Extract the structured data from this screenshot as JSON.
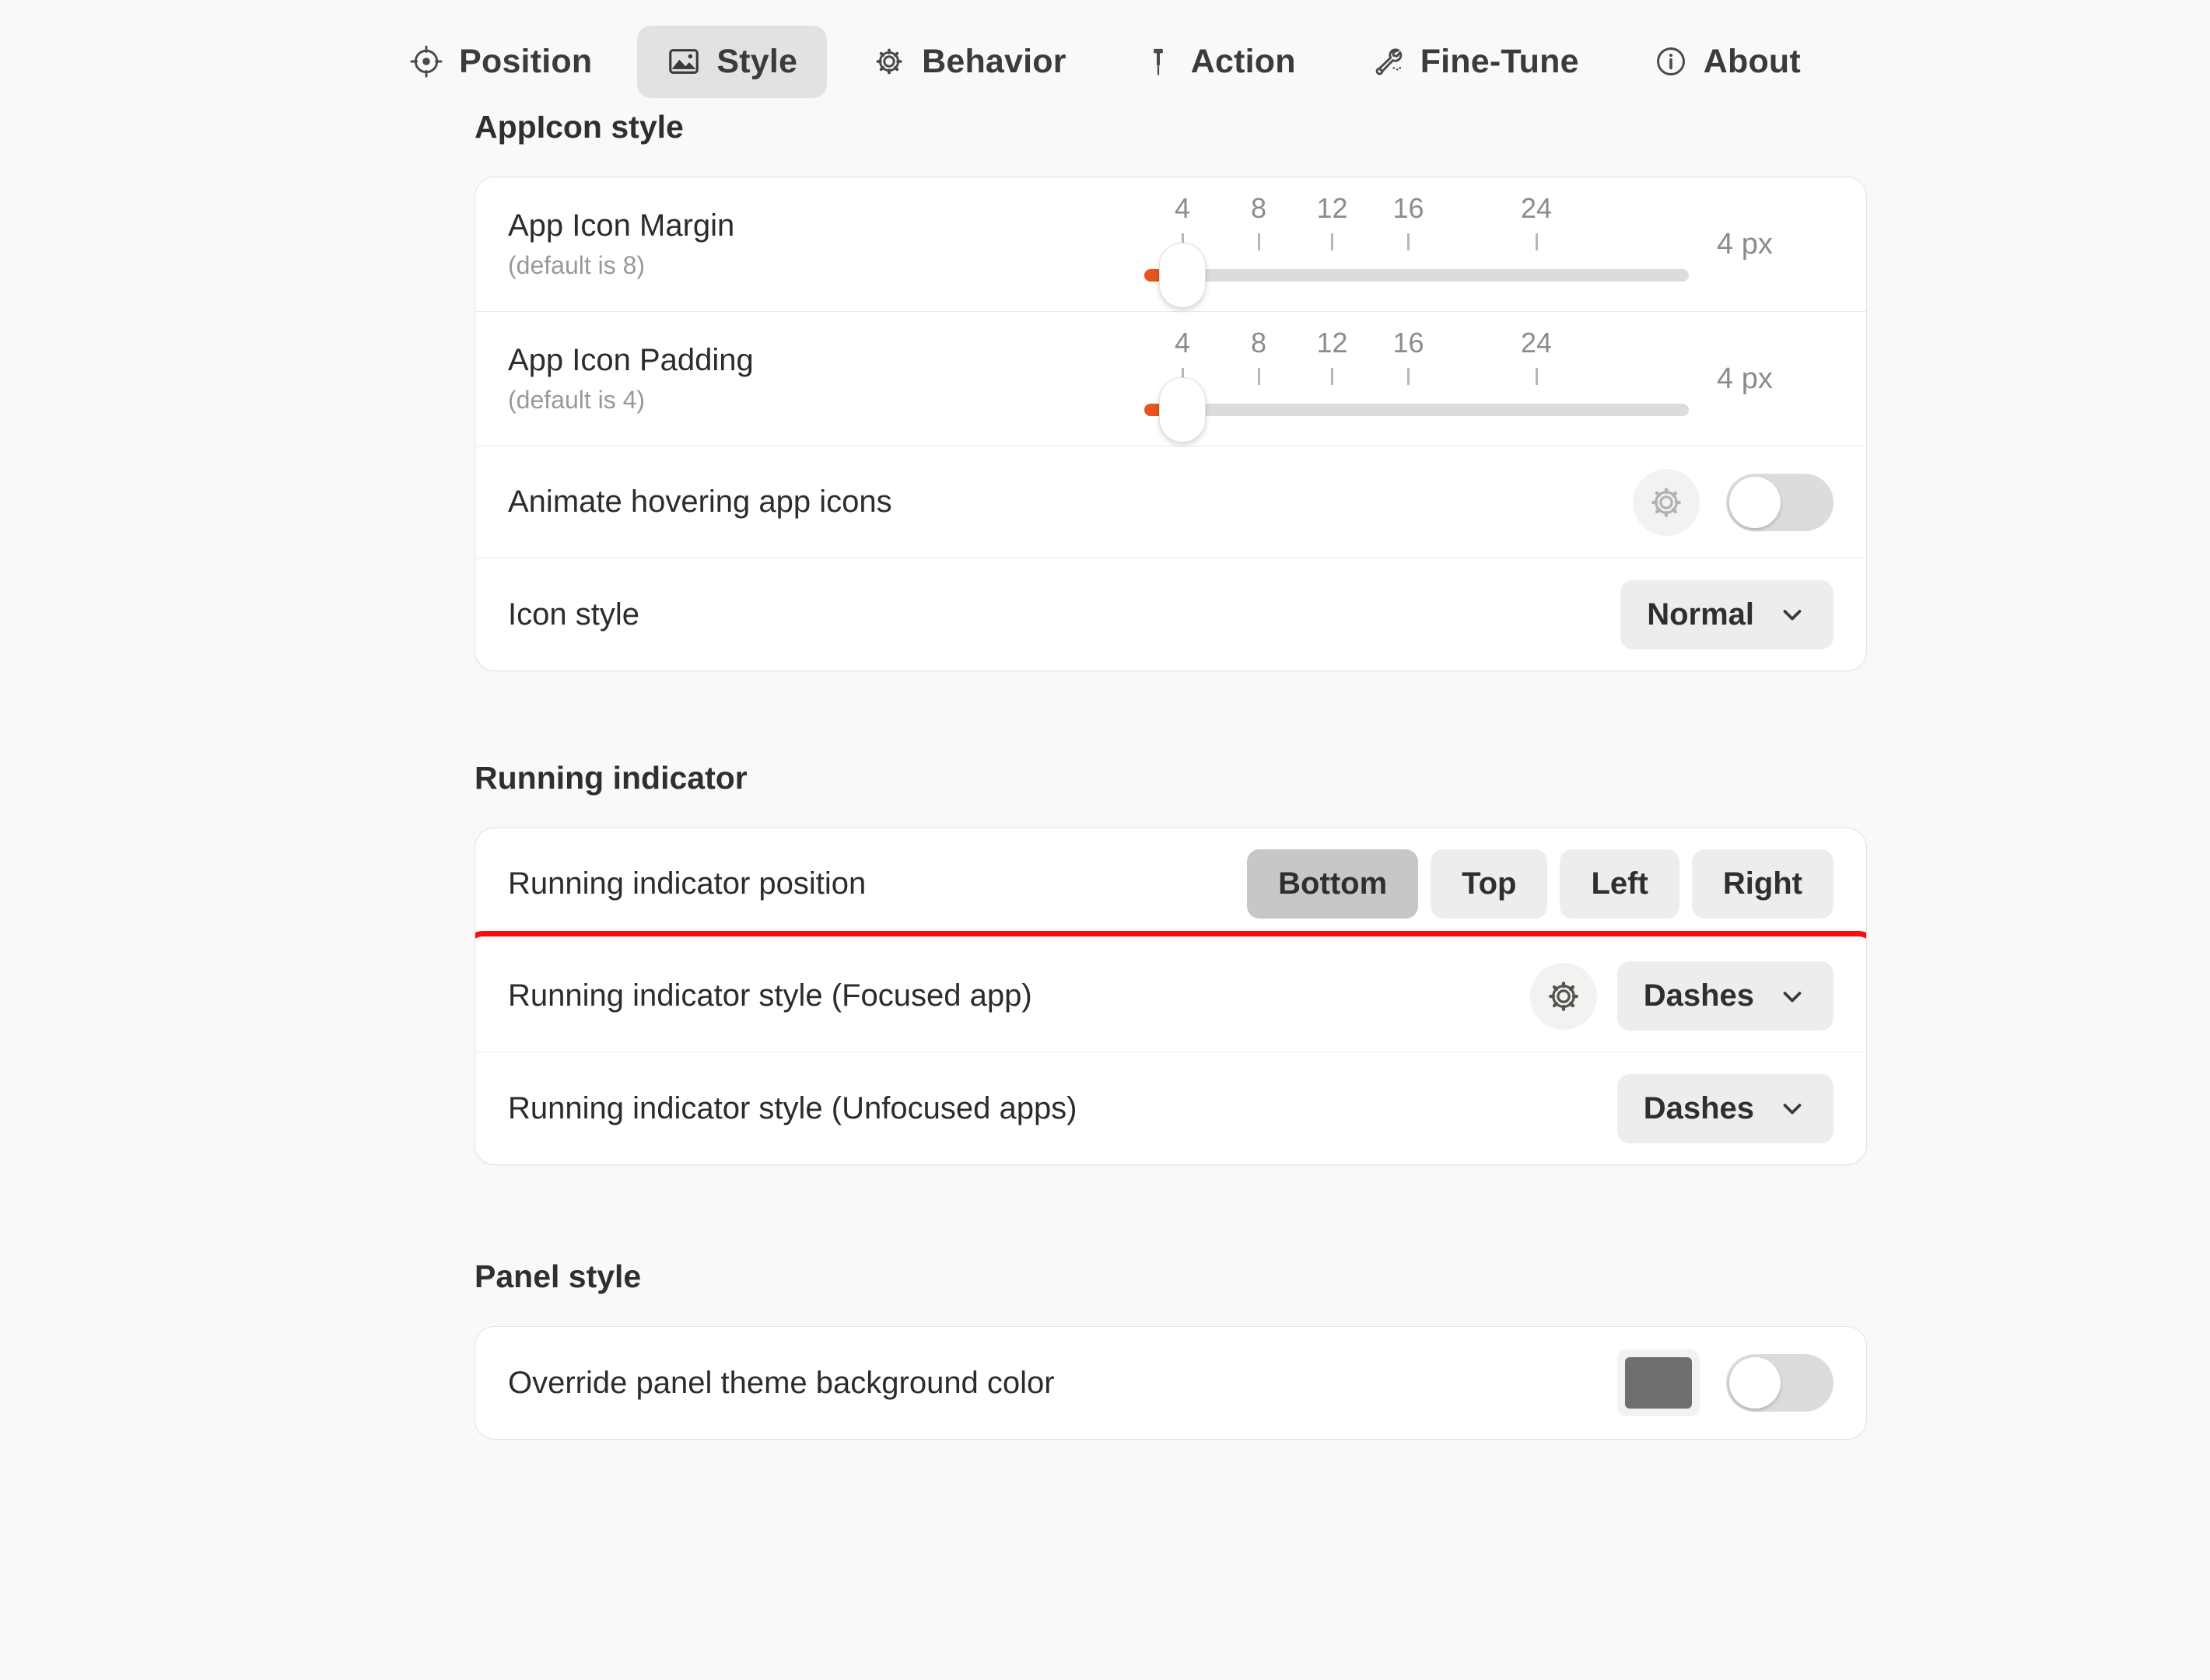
{
  "tabs": [
    {
      "label": "Position",
      "icon": "crosshair-icon",
      "active": false
    },
    {
      "label": "Style",
      "icon": "image-icon",
      "active": true
    },
    {
      "label": "Behavior",
      "icon": "gear-icon",
      "active": false
    },
    {
      "label": "Action",
      "icon": "pin-icon",
      "active": false
    },
    {
      "label": "Fine-Tune",
      "icon": "wrench-icon",
      "active": false
    },
    {
      "label": "About",
      "icon": "info-icon",
      "active": false
    }
  ],
  "sections": {
    "appicon": {
      "title": "AppIcon style",
      "margin": {
        "label": "App Icon Margin",
        "sublabel": "(default is 8)",
        "value": 4,
        "value_label": "4 px",
        "ticks": [
          4,
          8,
          12,
          16,
          24
        ],
        "tick_labels": [
          "4",
          "8",
          "12",
          "16",
          "24"
        ],
        "min": 0,
        "max": 32
      },
      "padding": {
        "label": "App Icon Padding",
        "sublabel": "(default is 4)",
        "value": 4,
        "value_label": "4 px",
        "ticks": [
          4,
          8,
          12,
          16,
          24
        ],
        "tick_labels": [
          "4",
          "8",
          "12",
          "16",
          "24"
        ],
        "min": 0,
        "max": 32
      },
      "animate": {
        "label": "Animate hovering app icons",
        "toggle_on": false,
        "has_gear": true
      },
      "icon_style": {
        "label": "Icon style",
        "value": "Normal",
        "options": [
          "Normal"
        ]
      }
    },
    "running": {
      "title": "Running indicator",
      "position": {
        "label": "Running indicator position",
        "options": [
          "Bottom",
          "Top",
          "Left",
          "Right"
        ],
        "selected": "Bottom"
      },
      "focused": {
        "label": "Running indicator style (Focused app)",
        "value": "Dashes",
        "has_gear": true,
        "highlighted": true
      },
      "unfocused": {
        "label": "Running indicator style (Unfocused apps)",
        "value": "Dashes",
        "has_gear": false,
        "highlighted": true
      }
    },
    "panel": {
      "title": "Panel style",
      "override": {
        "label": "Override panel theme background color",
        "swatch_color": "#6e6e6e",
        "toggle_on": false
      }
    }
  },
  "colors": {
    "accent": "#e8551f",
    "highlight": "#fb0d0d",
    "page_bg": "#faf9f8",
    "card_bg": "#ffffff"
  }
}
